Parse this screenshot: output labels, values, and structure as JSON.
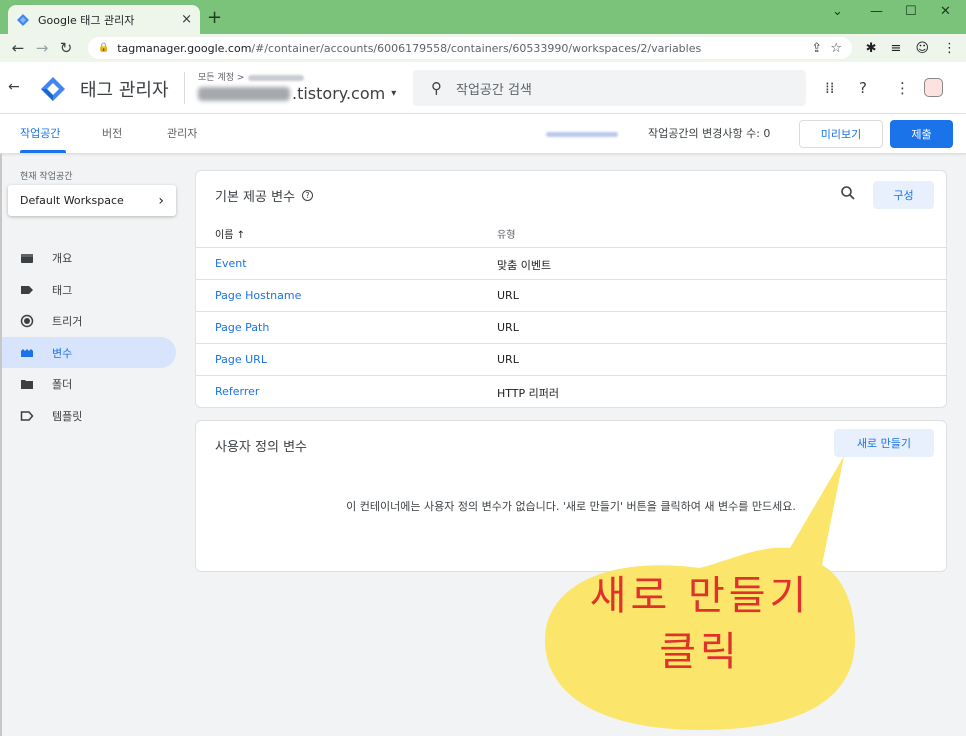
{
  "browser": {
    "tab_title": "Google 태그 관리자",
    "tab_close": "×",
    "new_tab": "+",
    "url_domain": "tagmanager.google.com",
    "url_path": "/#/container/accounts/6006179558/containers/60533990/workspaces/2/variables",
    "window_controls": [
      "⌄",
      "—",
      "☐",
      "✕"
    ]
  },
  "header": {
    "app_title": "태그 관리자",
    "account_label": "모든 계정 >",
    "container_suffix": ".tistory.com",
    "search_placeholder": "작업공간 검색"
  },
  "subnav": {
    "tabs": [
      "작업공간",
      "버전",
      "관리자"
    ],
    "changes_text": "작업공간의 변경사항 수: 0",
    "preview_label": "미리보기",
    "submit_label": "제출"
  },
  "sidebar": {
    "current_ws_label": "현재 작업공간",
    "workspace_name": "Default Workspace",
    "items": [
      {
        "label": "개요",
        "icon": "overview-icon"
      },
      {
        "label": "태그",
        "icon": "tag-icon"
      },
      {
        "label": "트리거",
        "icon": "trigger-icon"
      },
      {
        "label": "변수",
        "icon": "variables-icon",
        "active": true
      },
      {
        "label": "폴더",
        "icon": "folder-icon"
      },
      {
        "label": "템플릿",
        "icon": "template-icon"
      }
    ]
  },
  "builtin": {
    "title": "기본 제공 변수",
    "config_label": "구성",
    "col_name": "이름 ↑",
    "col_type": "유형",
    "rows": [
      {
        "name": "Event",
        "type": "맞춤 이벤트"
      },
      {
        "name": "Page Hostname",
        "type": "URL"
      },
      {
        "name": "Page Path",
        "type": "URL"
      },
      {
        "name": "Page URL",
        "type": "URL"
      },
      {
        "name": "Referrer",
        "type": "HTTP 리퍼러"
      }
    ]
  },
  "userdefined": {
    "title": "사용자 정의 변수",
    "new_label": "새로 만들기",
    "empty_text": "이 컨테이너에는 사용자 정의 변수가 없습니다. '새로 만들기' 버튼을 클릭하여 새 변수를 만드세요."
  },
  "annotation": {
    "line1": "새로 만들기",
    "line2": "클릭"
  },
  "colors": {
    "accent": "#1a73e8",
    "tabbar": "#7bc27b",
    "bubble": "#fbe56b",
    "annotation_text": "#e0322c"
  }
}
